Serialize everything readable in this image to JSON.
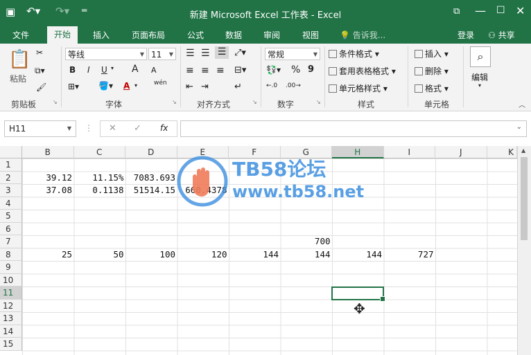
{
  "titlebar": {
    "title": "新建 Microsoft Excel 工作表 - Excel"
  },
  "tabs": [
    "文件",
    "开始",
    "插入",
    "页面布局",
    "公式",
    "数据",
    "审阅",
    "视图"
  ],
  "tell_me": "告诉我...",
  "login": "登录",
  "share": "共享",
  "ribbon": {
    "clipboard": {
      "label": "剪贴板",
      "paste": "粘贴"
    },
    "font": {
      "label": "字体",
      "name": "等线",
      "size": "11",
      "bold": "B",
      "italic": "I",
      "underline": "U",
      "grow": "A",
      "shrink": "A",
      "color": "A",
      "wen": "wén"
    },
    "align": {
      "label": "对齐方式"
    },
    "number": {
      "label": "数字",
      "format": "常规",
      "percent": "%",
      "comma": "9"
    },
    "styles": {
      "label": "样式",
      "cond": "条件格式",
      "table": "套用表格格式",
      "cell": "单元格样式"
    },
    "cells": {
      "label": "单元格",
      "insert": "插入",
      "delete": "删除",
      "format": "格式"
    },
    "edit": {
      "label": "编辑"
    }
  },
  "formula_bar": {
    "namebox": "H11",
    "fx": "fx",
    "value": ""
  },
  "columns": [
    "B",
    "C",
    "D",
    "E",
    "F",
    "G",
    "H",
    "I",
    "J",
    "K"
  ],
  "rows": [
    "1",
    "2",
    "3",
    "4",
    "5",
    "6",
    "7",
    "8",
    "9",
    "10",
    "11",
    "12",
    "13",
    "14",
    "15"
  ],
  "selected": {
    "col": "H",
    "row": "11"
  },
  "cells": {
    "r2": {
      "B": "39.12",
      "C": "11.15%",
      "D": "7083.693",
      "E": ""
    },
    "r3": {
      "B": "37.08",
      "C": "0.1138",
      "D": "51514.15",
      "E": "660.4378"
    },
    "r7": {
      "G": "700"
    },
    "r8": {
      "B": "25",
      "C": "50",
      "D": "100",
      "E": "120",
      "F": "144",
      "G": "144",
      "H": "144",
      "I": "727"
    }
  },
  "watermark": {
    "title": "TB58论坛",
    "url": "www.tb58.net"
  },
  "colors": {
    "accent": "#217346",
    "watermark": "#3d8fe0"
  }
}
